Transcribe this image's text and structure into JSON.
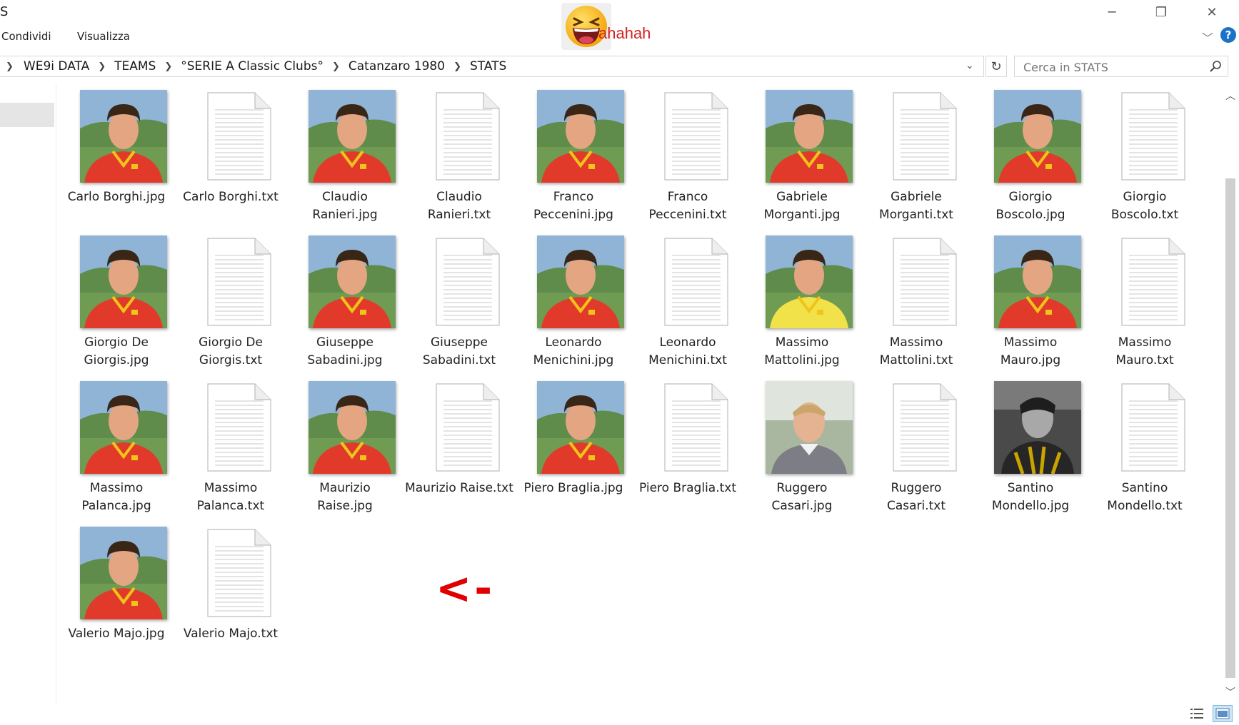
{
  "window": {
    "title": "S",
    "minimize_glyph": "─",
    "restore_glyph": "❐",
    "close_glyph": "✕"
  },
  "ribbon": {
    "tabs": [
      "Condividi",
      "Visualizza"
    ],
    "expand_glyph": "﹀",
    "help_label": "?"
  },
  "overlay": {
    "text": "ahahah",
    "emoji": "laughing-face"
  },
  "address": {
    "crumbs": [
      "WE9i DATA",
      "TEAMS",
      "°SERIE A Classic Clubs°",
      "Catanzaro 1980",
      "STATS"
    ],
    "dropdown_glyph": "⌄",
    "refresh_glyph": "↻"
  },
  "search": {
    "placeholder": "Cerca in STATS"
  },
  "files": [
    {
      "label": "Carlo Borghi.jpg",
      "type": "jpg"
    },
    {
      "label": "Carlo Borghi.txt",
      "type": "txt"
    },
    {
      "label": "Claudio\nRanieri.jpg",
      "type": "jpg"
    },
    {
      "label": "Claudio\nRanieri.txt",
      "type": "txt"
    },
    {
      "label": "Franco\nPeccenini.jpg",
      "type": "jpg"
    },
    {
      "label": "Franco\nPeccenini.txt",
      "type": "txt"
    },
    {
      "label": "Gabriele\nMorganti.jpg",
      "type": "jpg"
    },
    {
      "label": "Gabriele\nMorganti.txt",
      "type": "txt"
    },
    {
      "label": "Giorgio\nBoscolo.jpg",
      "type": "jpg"
    },
    {
      "label": "Giorgio\nBoscolo.txt",
      "type": "txt"
    },
    {
      "label": "Giorgio De\nGiorgis.jpg",
      "type": "jpg"
    },
    {
      "label": "Giorgio De\nGiorgis.txt",
      "type": "txt"
    },
    {
      "label": "Giuseppe\nSabadini.jpg",
      "type": "jpg"
    },
    {
      "label": "Giuseppe\nSabadini.txt",
      "type": "txt"
    },
    {
      "label": "Leonardo\nMenichini.jpg",
      "type": "jpg"
    },
    {
      "label": "Leonardo\nMenichini.txt",
      "type": "txt"
    },
    {
      "label": "Massimo\nMattolini.jpg",
      "type": "jpg"
    },
    {
      "label": "Massimo\nMattolini.txt",
      "type": "txt"
    },
    {
      "label": "Massimo\nMauro.jpg",
      "type": "jpg"
    },
    {
      "label": "Massimo\nMauro.txt",
      "type": "txt"
    },
    {
      "label": "Massimo\nPalanca.jpg",
      "type": "jpg"
    },
    {
      "label": "Massimo\nPalanca.txt",
      "type": "txt"
    },
    {
      "label": "Maurizio\nRaise.jpg",
      "type": "jpg"
    },
    {
      "label": "Maurizio Raise.txt",
      "type": "txt"
    },
    {
      "label": "Piero Braglia.jpg",
      "type": "jpg"
    },
    {
      "label": "Piero Braglia.txt",
      "type": "txt"
    },
    {
      "label": "Ruggero\nCasari.jpg",
      "type": "jpg"
    },
    {
      "label": "Ruggero\nCasari.txt",
      "type": "txt"
    },
    {
      "label": "Santino\nMondello.jpg",
      "type": "jpg"
    },
    {
      "label": "Santino\nMondello.txt",
      "type": "txt"
    },
    {
      "label": "Valerio Majo.jpg",
      "type": "jpg"
    },
    {
      "label": "Valerio Majo.txt",
      "type": "txt"
    }
  ],
  "annotation": {
    "text": "<-",
    "color": "#e00000"
  },
  "scrollbar": {
    "up_glyph": "︿",
    "down_glyph": "﹀"
  },
  "colors": {
    "jersey_red": "#e23a2a",
    "jersey_yellow_collar": "#f0c419",
    "keeper_yellow": "#f2e24a",
    "accent_blue": "#1a73c7"
  }
}
